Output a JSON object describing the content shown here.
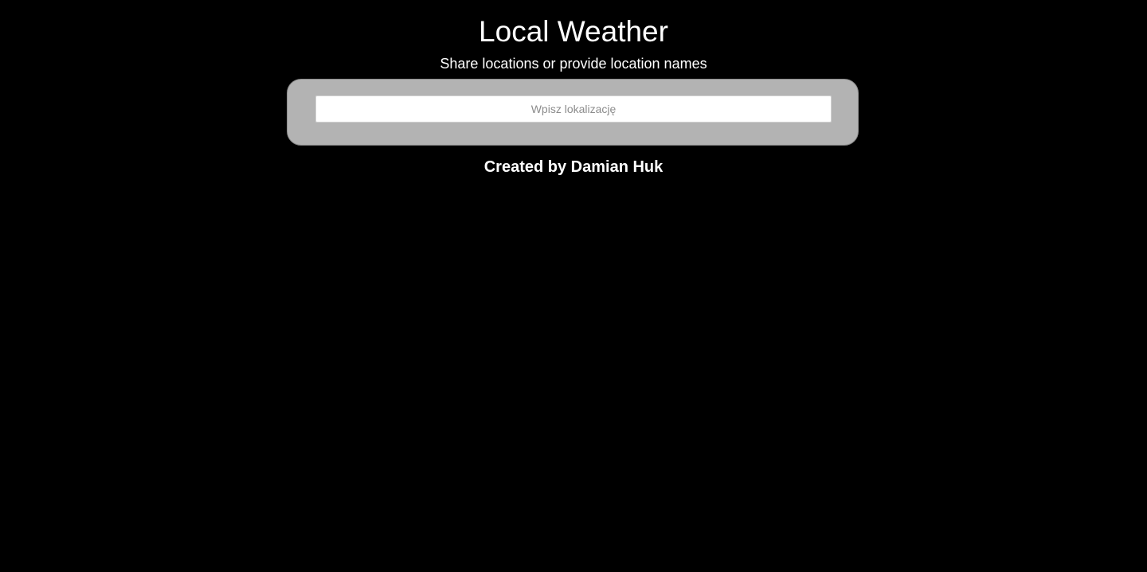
{
  "header": {
    "title": "Local Weather",
    "subtitle": "Share locations or provide location names"
  },
  "search": {
    "value": "",
    "placeholder": "Wpisz lokalizację"
  },
  "footer": {
    "credit": "Created by Damian Huk"
  },
  "colors": {
    "background": "#000000",
    "panel": "#b3b3b3",
    "text": "#ffffff"
  }
}
